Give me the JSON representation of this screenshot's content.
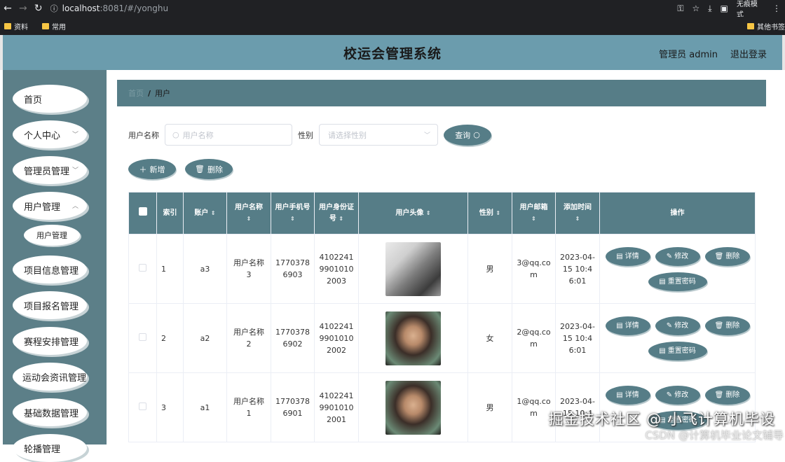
{
  "browser": {
    "url_host": "localhost",
    "url_rest": ":8081/#/yonghu",
    "incognito": "无痕模式",
    "bookmarks": [
      "资料",
      "常用"
    ],
    "other_bookmarks": "其他书签"
  },
  "header": {
    "title": "校运会管理系统",
    "user": "管理员 admin",
    "logout": "退出登录"
  },
  "sidebar": {
    "items": [
      {
        "label": "首页",
        "has_arrow": false
      },
      {
        "label": "个人中心",
        "has_arrow": true
      },
      {
        "label": "管理员管理",
        "has_arrow": true
      },
      {
        "label": "用户管理",
        "has_arrow": true
      },
      {
        "label": "项目信息管理",
        "has_arrow": false
      },
      {
        "label": "项目报名管理",
        "has_arrow": false
      },
      {
        "label": "赛程安排管理",
        "has_arrow": false
      },
      {
        "label": "运动会资讯管理",
        "has_arrow": false
      },
      {
        "label": "基础数据管理",
        "has_arrow": false
      },
      {
        "label": "轮播管理",
        "has_arrow": false
      }
    ],
    "submenu_item": "用户管理"
  },
  "breadcrumb": {
    "home": "首页",
    "separator": "/",
    "current": "用户"
  },
  "search": {
    "name_label": "用户名称",
    "name_placeholder": "用户名称",
    "gender_label": "性别",
    "gender_placeholder": "请选择性别",
    "query_button": "查询"
  },
  "actions": {
    "add": "新增",
    "delete": "删除"
  },
  "table": {
    "columns": [
      "索引",
      "账户",
      "用户名称",
      "用户手机号",
      "用户身份证号",
      "用户头像",
      "性别",
      "用户邮箱",
      "添加时间",
      "操作"
    ],
    "rows": [
      {
        "index": "1",
        "account": "a3",
        "name": "用户名称3",
        "phone": "17703786903",
        "id_card": "410224199010102003",
        "gender": "男",
        "email": "3@qq.com",
        "added": "2023-04-15 10:46:01"
      },
      {
        "index": "2",
        "account": "a2",
        "name": "用户名称2",
        "phone": "17703786902",
        "id_card": "410224199010102002",
        "gender": "女",
        "email": "2@qq.com",
        "added": "2023-04-15 10:46:01"
      },
      {
        "index": "3",
        "account": "a1",
        "name": "用户名称1",
        "phone": "17703786901",
        "id_card": "410224199010102001",
        "gender": "男",
        "email": "1@qq.com",
        "added": "2023-04-15 10:4"
      }
    ],
    "ops": {
      "detail": "详情",
      "edit": "修改",
      "delete": "删除",
      "reset": "重置密码"
    }
  },
  "watermark": {
    "line1": "掘金技术社区 @ 小飞计算机毕设",
    "line2": "CSDN @计算机毕业论文辅导"
  }
}
